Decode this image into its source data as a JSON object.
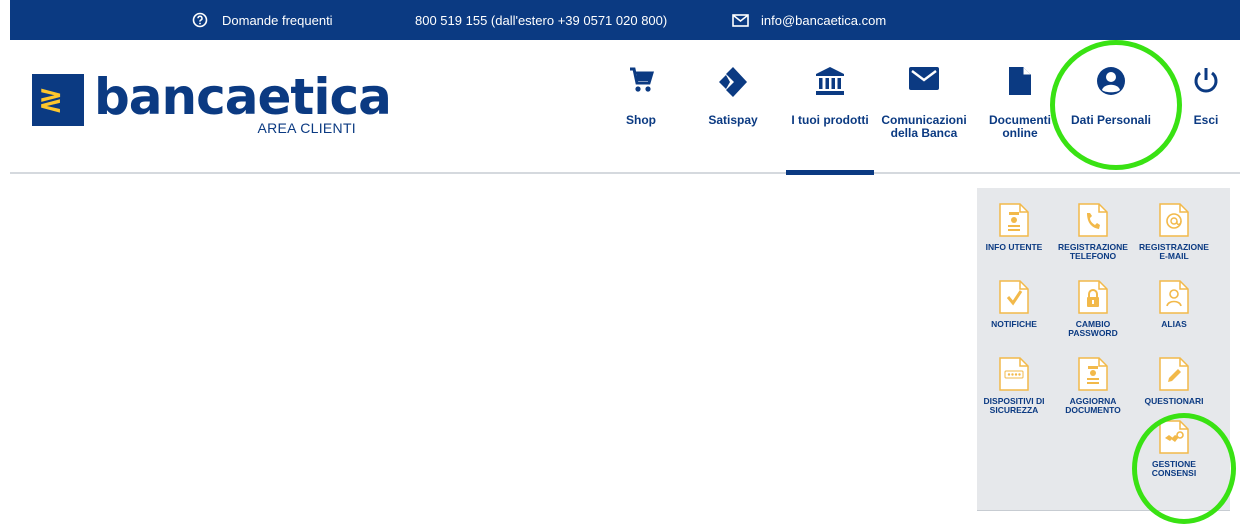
{
  "topbar": {
    "faq_label": "Domande frequenti",
    "phone_label": "800 519 155 (dall'estero +39 0571 020 800)",
    "email_label": "info@bancaetica.com"
  },
  "logo": {
    "mark": "≷",
    "wordmark": "bancaetica",
    "subtitle": "AREA CLIENTI"
  },
  "nav": {
    "shop": "Shop",
    "satispay": "Satispay",
    "prodotti": "I tuoi prodotti",
    "comunicazioni": "Comunicazioni della Banca",
    "documenti": "Documenti online",
    "dati": "Dati Personali",
    "esci": "Esci",
    "active": "I tuoi prodotti"
  },
  "panel": {
    "items": [
      {
        "label": "INFO UTENTE",
        "icon": "person-card-icon"
      },
      {
        "label": "REGISTRAZIONE TELEFONO",
        "icon": "phone-icon"
      },
      {
        "label": "REGISTRAZIONE E-MAIL",
        "icon": "at-sign-icon"
      },
      {
        "label": "NOTIFICHE",
        "icon": "checkmark-icon"
      },
      {
        "label": "CAMBIO PASSWORD",
        "icon": "padlock-icon"
      },
      {
        "label": "ALIAS",
        "icon": "user-outline-icon"
      },
      {
        "label": "DISPOSITIVI DI SICUREZZA",
        "icon": "password-dots-icon"
      },
      {
        "label": "AGGIORNA DOCUMENTO",
        "icon": "id-document-icon"
      },
      {
        "label": "QUESTIONARI",
        "icon": "pencil-icon"
      },
      {
        "label": "GESTIONE CONSENSI",
        "icon": "handshake-icon"
      }
    ]
  },
  "colors": {
    "brand_blue": "#0b3a82",
    "brand_yellow": "#ffc72c",
    "tile_icon": "#f2b94a",
    "highlight_circle": "#39e213",
    "panel_bg": "#e6e8eb"
  }
}
